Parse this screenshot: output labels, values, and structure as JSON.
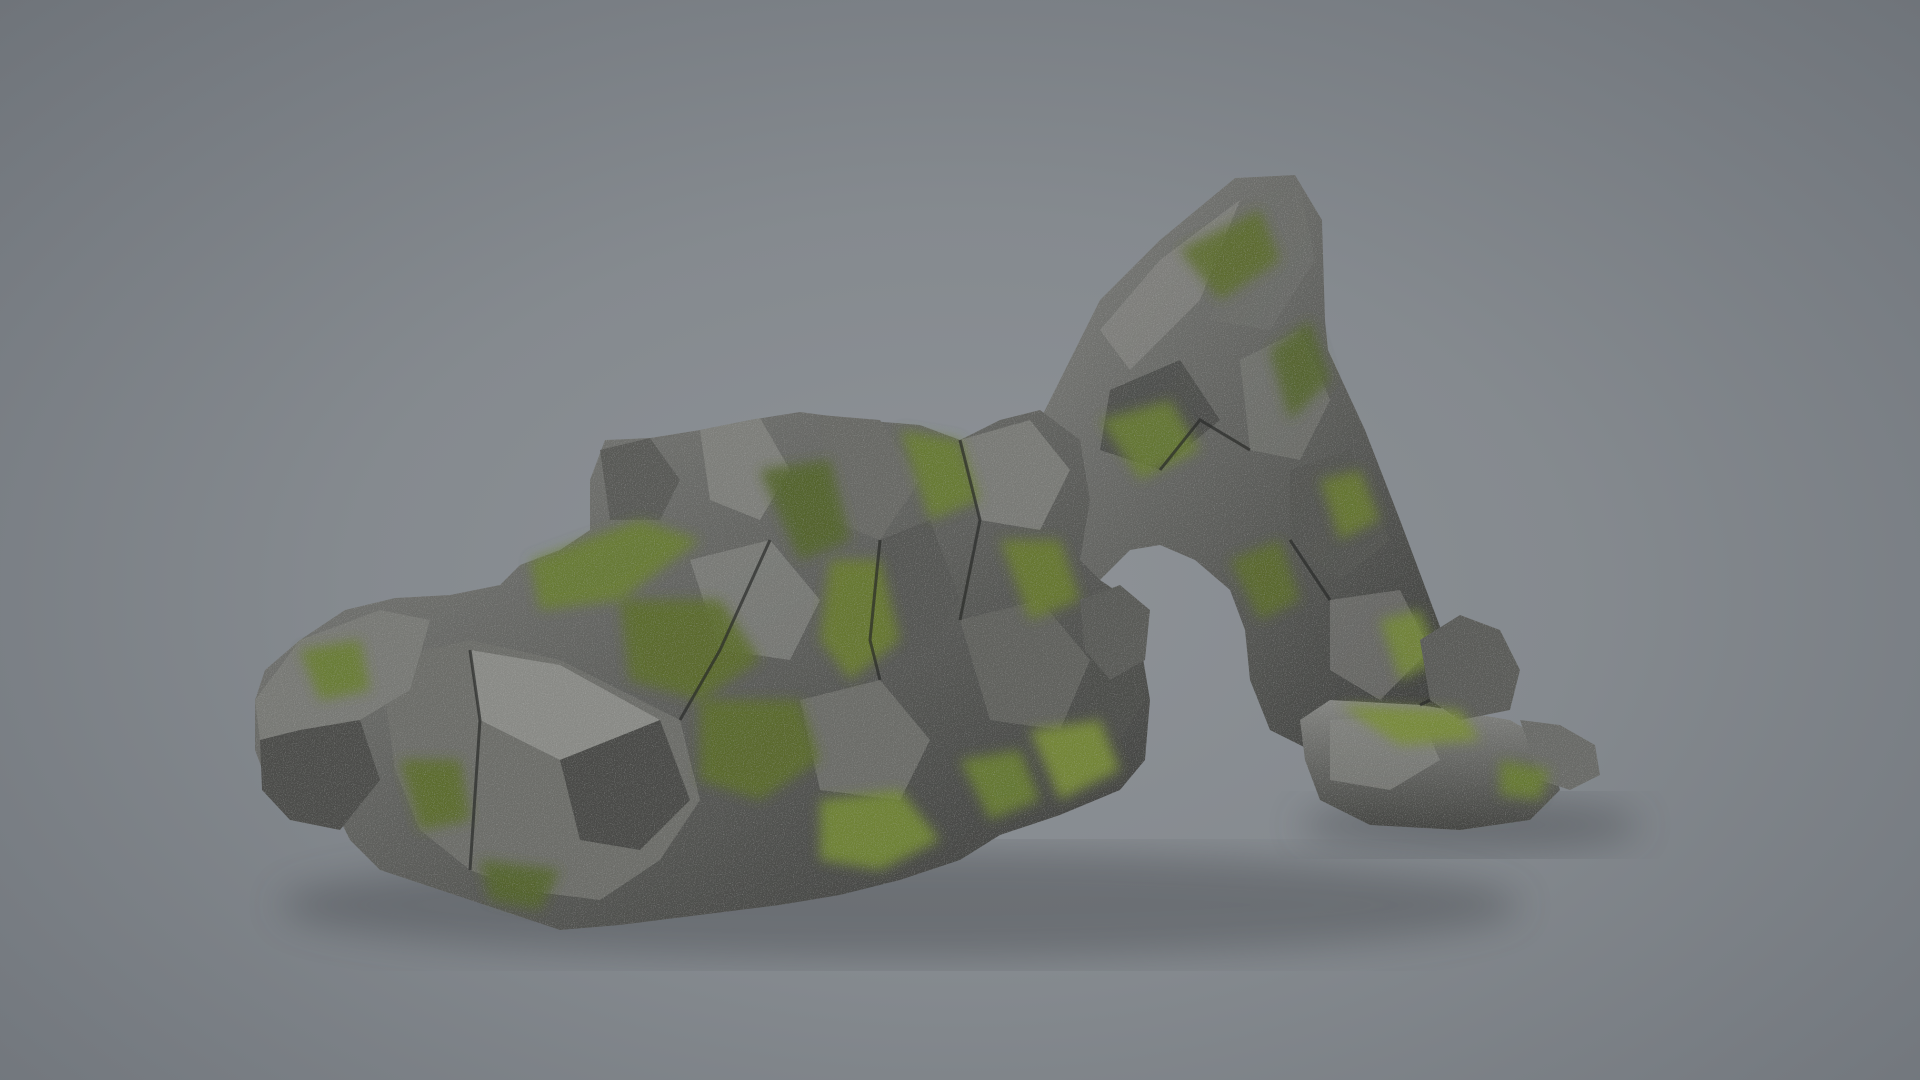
{
  "scene": {
    "subject": "mossy-rock-arch",
    "colors": {
      "background_center": "#8e9297",
      "background_edge": "#6f747a",
      "rock_light": "#7d7d7b",
      "rock_mid": "#5e5f5c",
      "rock_dark": "#3a3b39",
      "moss_light": "#7c8f3a",
      "moss_mid": "#5d6e2a",
      "moss_dark": "#3f4b1f",
      "shadow": "#2a2c2b"
    }
  }
}
